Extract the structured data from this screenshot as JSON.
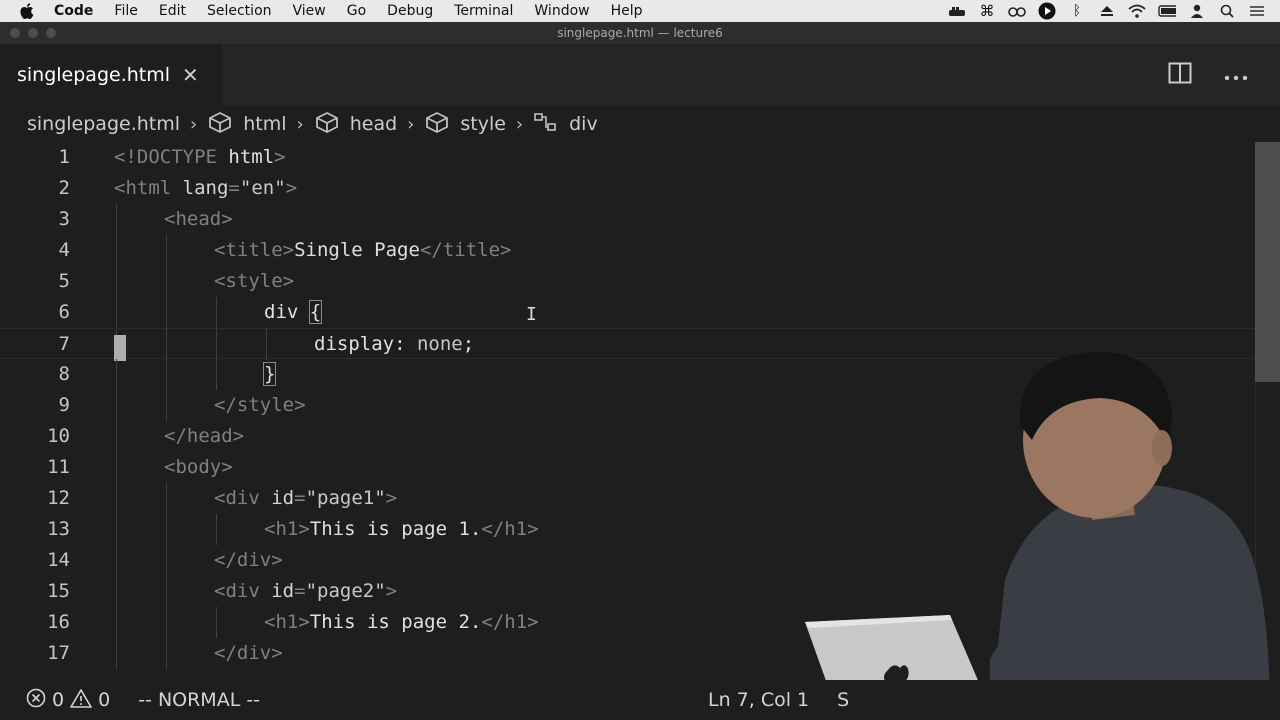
{
  "menubar": {
    "app": "Code",
    "items": [
      "File",
      "Edit",
      "Selection",
      "View",
      "Go",
      "Debug",
      "Terminal",
      "Window",
      "Help"
    ],
    "status_icons": [
      "docker-icon",
      "command-icon",
      "glasses-icon",
      "play-circle-icon",
      "bluetooth-icon",
      "eject-icon",
      "wifi-icon",
      "battery-icon",
      "user-icon",
      "search-icon",
      "list-icon"
    ]
  },
  "window": {
    "title": "singlepage.html — lecture6"
  },
  "tab": {
    "label": "singlepage.html",
    "close": "✕"
  },
  "breadcrumbs": {
    "file": "singlepage.html",
    "items": [
      {
        "label": "html",
        "icon": "cube-icon"
      },
      {
        "label": "head",
        "icon": "cube-icon"
      },
      {
        "label": "style",
        "icon": "cube-icon"
      },
      {
        "label": "div",
        "icon": "symbol-class-icon"
      }
    ]
  },
  "editor": {
    "lines": [
      {
        "n": "1",
        "indent": 0,
        "tokens": [
          [
            "t-punc",
            "<!"
          ],
          [
            "t-tag",
            "DOCTYPE"
          ],
          [
            "t-text",
            " html"
          ],
          [
            "t-punc",
            ">"
          ]
        ]
      },
      {
        "n": "2",
        "indent": 0,
        "tokens": [
          [
            "t-punc",
            "<"
          ],
          [
            "t-tag",
            "html"
          ],
          [
            "t-attr",
            " lang"
          ],
          [
            "t-punc",
            "="
          ],
          [
            "t-val",
            "\"en\""
          ],
          [
            "t-punc",
            ">"
          ]
        ]
      },
      {
        "n": "3",
        "indent": 1,
        "tokens": [
          [
            "t-punc",
            "<"
          ],
          [
            "t-tag",
            "head"
          ],
          [
            "t-punc",
            ">"
          ]
        ]
      },
      {
        "n": "4",
        "indent": 2,
        "tokens": [
          [
            "t-punc",
            "<"
          ],
          [
            "t-tag",
            "title"
          ],
          [
            "t-punc",
            ">"
          ],
          [
            "t-text",
            "Single Page"
          ],
          [
            "t-punc",
            "</"
          ],
          [
            "t-tag",
            "title"
          ],
          [
            "t-punc",
            ">"
          ]
        ]
      },
      {
        "n": "5",
        "indent": 2,
        "tokens": [
          [
            "t-punc",
            "<"
          ],
          [
            "t-tag",
            "style"
          ],
          [
            "t-punc",
            ">"
          ]
        ]
      },
      {
        "n": "6",
        "indent": 3,
        "tokens": [
          [
            "t-text",
            "div "
          ],
          [
            "t-text bracket-box",
            "{"
          ]
        ]
      },
      {
        "n": "7",
        "indent": 4,
        "tokens": [
          [
            "t-prop",
            "display"
          ],
          [
            "t-text",
            ": "
          ],
          [
            "t-val",
            "none"
          ],
          [
            "t-text",
            ";"
          ]
        ]
      },
      {
        "n": "8",
        "indent": 3,
        "tokens": [
          [
            "t-text bracket-box",
            "}"
          ]
        ]
      },
      {
        "n": "9",
        "indent": 2,
        "tokens": [
          [
            "t-punc",
            "</"
          ],
          [
            "t-tag",
            "style"
          ],
          [
            "t-punc",
            ">"
          ]
        ]
      },
      {
        "n": "10",
        "indent": 1,
        "tokens": [
          [
            "t-punc",
            "</"
          ],
          [
            "t-tag",
            "head"
          ],
          [
            "t-punc",
            ">"
          ]
        ]
      },
      {
        "n": "11",
        "indent": 1,
        "tokens": [
          [
            "t-punc",
            "<"
          ],
          [
            "t-tag",
            "body"
          ],
          [
            "t-punc",
            ">"
          ]
        ]
      },
      {
        "n": "12",
        "indent": 2,
        "tokens": [
          [
            "t-punc",
            "<"
          ],
          [
            "t-tag",
            "div"
          ],
          [
            "t-attr",
            " id"
          ],
          [
            "t-punc",
            "="
          ],
          [
            "t-val",
            "\"page1\""
          ],
          [
            "t-punc",
            ">"
          ]
        ]
      },
      {
        "n": "13",
        "indent": 3,
        "tokens": [
          [
            "t-punc",
            "<"
          ],
          [
            "t-tag",
            "h1"
          ],
          [
            "t-punc",
            ">"
          ],
          [
            "t-text",
            "This is page 1."
          ],
          [
            "t-punc",
            "</"
          ],
          [
            "t-tag",
            "h1"
          ],
          [
            "t-punc",
            ">"
          ]
        ]
      },
      {
        "n": "14",
        "indent": 2,
        "tokens": [
          [
            "t-punc",
            "</"
          ],
          [
            "t-tag",
            "div"
          ],
          [
            "t-punc",
            ">"
          ]
        ]
      },
      {
        "n": "15",
        "indent": 2,
        "tokens": [
          [
            "t-punc",
            "<"
          ],
          [
            "t-tag",
            "div"
          ],
          [
            "t-attr",
            " id"
          ],
          [
            "t-punc",
            "="
          ],
          [
            "t-val",
            "\"page2\""
          ],
          [
            "t-punc",
            ">"
          ]
        ]
      },
      {
        "n": "16",
        "indent": 3,
        "tokens": [
          [
            "t-punc",
            "<"
          ],
          [
            "t-tag",
            "h1"
          ],
          [
            "t-punc",
            ">"
          ],
          [
            "t-text",
            "This is page 2."
          ],
          [
            "t-punc",
            "</"
          ],
          [
            "t-tag",
            "h1"
          ],
          [
            "t-punc",
            ">"
          ]
        ]
      },
      {
        "n": "17",
        "indent": 2,
        "tokens": [
          [
            "t-punc",
            "</"
          ],
          [
            "t-tag",
            "div"
          ],
          [
            "t-punc",
            ">"
          ]
        ]
      }
    ],
    "current_line": "7"
  },
  "statusbar": {
    "errors": "0",
    "warnings": "0",
    "mode": "-- NORMAL --",
    "position": "Ln 7, Col 1",
    "spaces": "S"
  }
}
